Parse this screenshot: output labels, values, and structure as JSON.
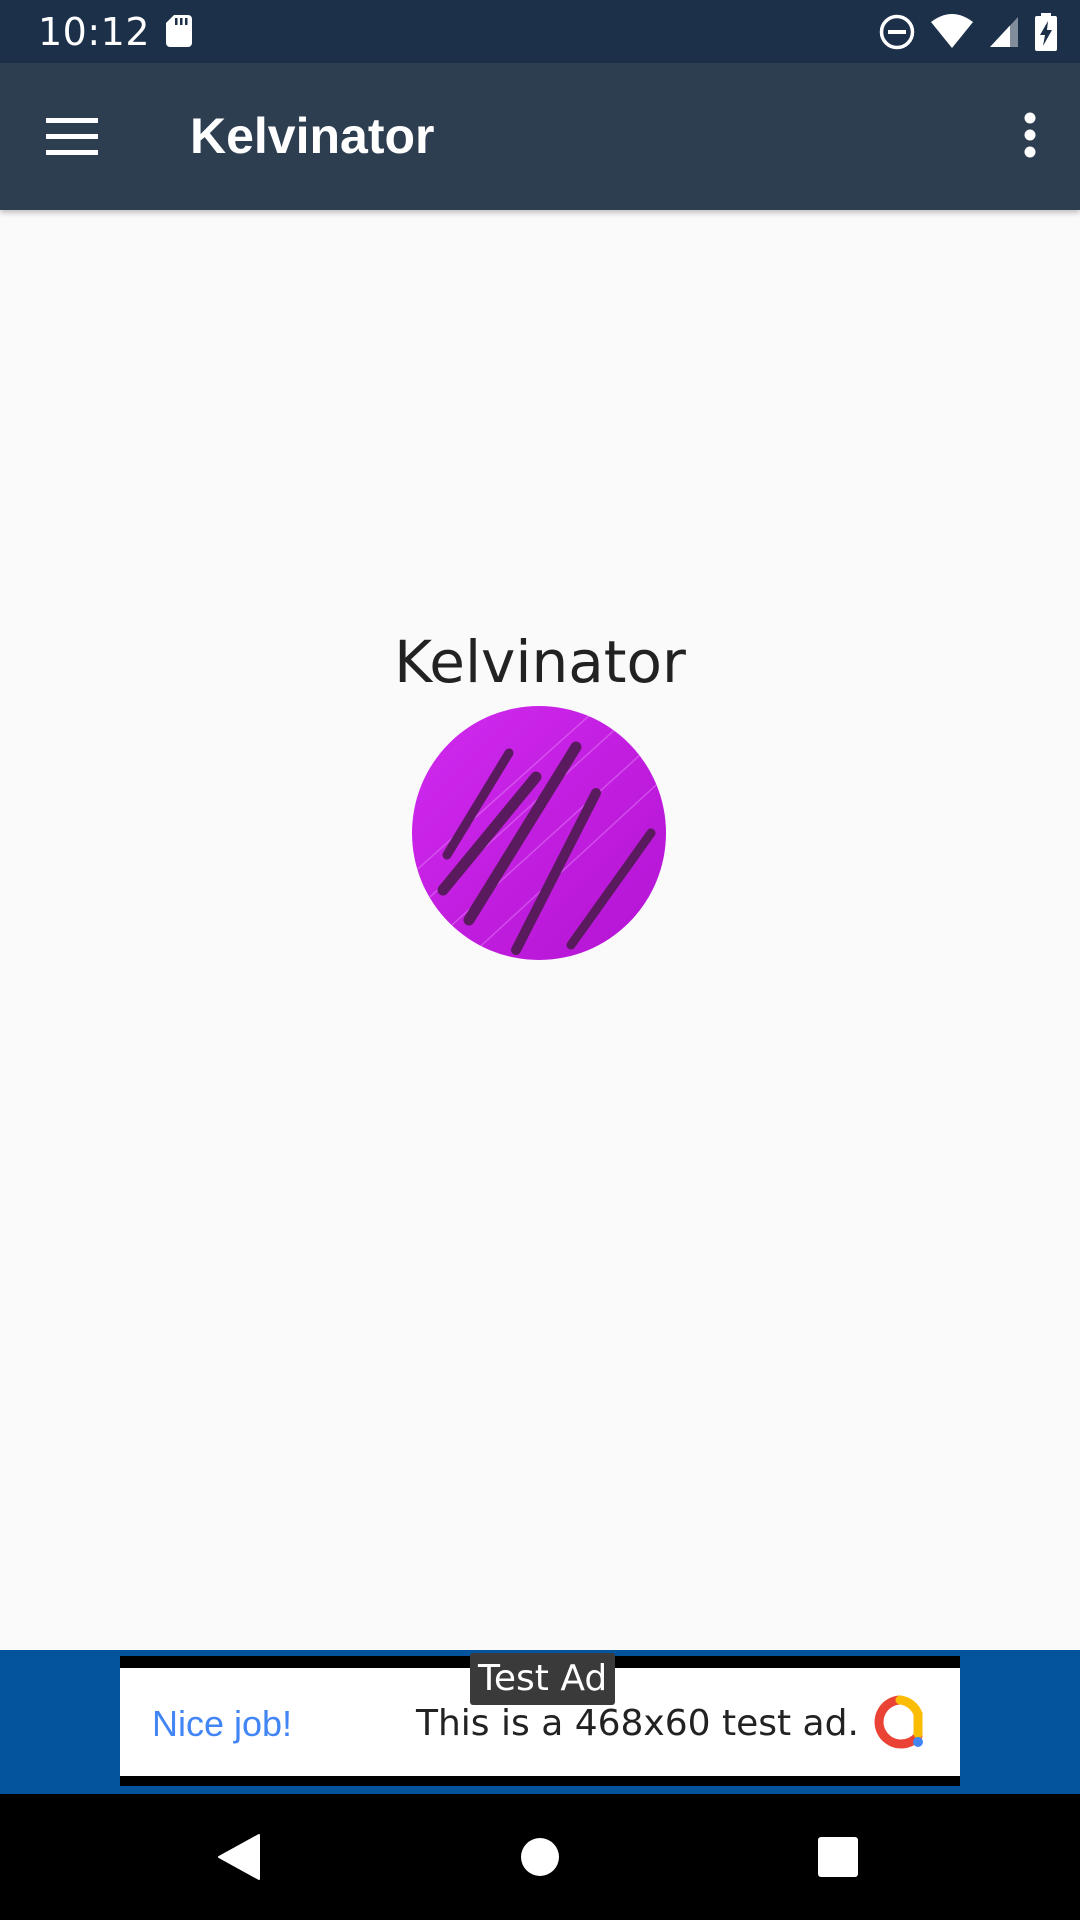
{
  "status_bar": {
    "time": "10:12",
    "icons": [
      "sd-card-icon",
      "do-not-disturb-icon",
      "wifi-icon",
      "cell-signal-icon",
      "battery-charging-icon"
    ]
  },
  "app_bar": {
    "title": "Kelvinator",
    "menu_icon": "hamburger-menu-icon",
    "overflow_icon": "more-vert-icon"
  },
  "main": {
    "device_name": "Kelvinator",
    "avatar_color": "#c21ee0"
  },
  "ad": {
    "label": "Test Ad",
    "left_text": "Nice job!",
    "main_text": "This is a 468x60 test ad.",
    "background_color": "#04539d"
  },
  "nav_bar": {
    "buttons": [
      "back-icon",
      "home-icon",
      "recents-icon"
    ]
  }
}
